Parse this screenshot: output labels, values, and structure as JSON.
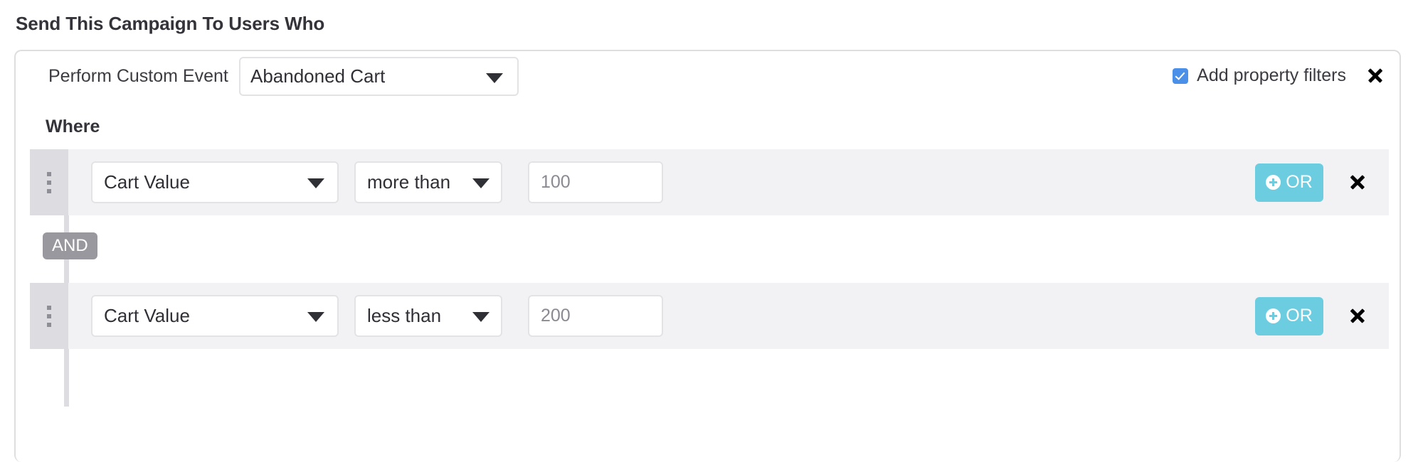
{
  "page": {
    "section_title": "Send This Campaign To Users Who"
  },
  "event_block": {
    "event_label": "Perform Custom Event",
    "event_select": {
      "value": "Abandoned Cart",
      "icon": "chevron-down-icon"
    },
    "property_filters": {
      "label": "Add property filters",
      "checked": true,
      "checkbox_color": "#4a90e8"
    },
    "close_icon": "close-icon",
    "where_label": "Where"
  },
  "filters": {
    "join_operator": "AND",
    "rows": [
      {
        "drag_handle_icon": "drag-handle-icon",
        "field": "Cart Value",
        "operator": "more than",
        "value": "",
        "value_placeholder": "100",
        "or_button_label": "OR",
        "or_button_icon": "plus-circle-icon",
        "close_icon": "close-icon"
      },
      {
        "drag_handle_icon": "drag-handle-icon",
        "field": "Cart Value",
        "operator": "less than",
        "value": "",
        "value_placeholder": "200",
        "or_button_label": "OR",
        "or_button_icon": "plus-circle-icon",
        "close_icon": "close-icon"
      }
    ]
  },
  "colors": {
    "accent_cyan": "#6ccde0",
    "checkbox_blue": "#4a90e8",
    "row_background": "#f2f2f5",
    "handle_gray": "#dcdce1",
    "badge_gray": "#98989e",
    "card_border": "#dededf"
  }
}
